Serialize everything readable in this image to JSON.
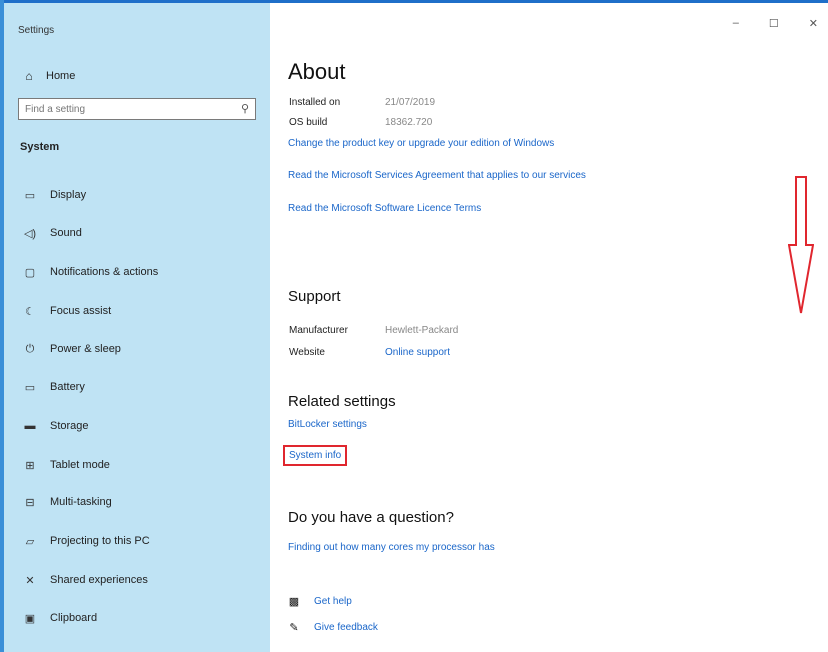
{
  "window": {
    "title": "Settings",
    "controls": {
      "minimize": "–",
      "maximize": "☐",
      "close": "✕"
    }
  },
  "sidebar": {
    "home": {
      "icon": "home-icon",
      "glyph": "⌂",
      "label": "Home"
    },
    "search": {
      "placeholder": "Find a setting",
      "icon": "search-icon",
      "glyph": "⚲"
    },
    "section": "System",
    "items": [
      {
        "icon": "display-icon",
        "glyph": "▭",
        "label": "Display"
      },
      {
        "icon": "sound-icon",
        "glyph": "◁)",
        "label": "Sound"
      },
      {
        "icon": "notifications-icon",
        "glyph": "▢",
        "label": "Notifications & actions"
      },
      {
        "icon": "focus-assist-icon",
        "glyph": "☾",
        "label": "Focus assist"
      },
      {
        "icon": "power-icon",
        "glyph": "⏻",
        "label": "Power & sleep"
      },
      {
        "icon": "battery-icon",
        "glyph": "▭",
        "label": "Battery"
      },
      {
        "icon": "storage-icon",
        "glyph": "▬",
        "label": "Storage"
      },
      {
        "icon": "tablet-icon",
        "glyph": "⊞",
        "label": "Tablet mode"
      },
      {
        "icon": "multitasking-icon",
        "glyph": "⊟",
        "label": "Multi-tasking"
      },
      {
        "icon": "projecting-icon",
        "glyph": "▱",
        "label": "Projecting to this PC"
      },
      {
        "icon": "shared-experiences-icon",
        "glyph": "✕",
        "label": "Shared experiences"
      },
      {
        "icon": "clipboard-icon",
        "glyph": "▣",
        "label": "Clipboard"
      }
    ]
  },
  "main": {
    "title": "About",
    "specs": [
      {
        "label": "Installed on",
        "value": "21/07/2019"
      },
      {
        "label": "OS build",
        "value": "18362.720"
      }
    ],
    "links": [
      "Change the product key or upgrade your edition of Windows",
      "Read the Microsoft Services Agreement that applies to our services",
      "Read the Microsoft Software Licence Terms"
    ],
    "support": {
      "heading": "Support",
      "manufacturer_label": "Manufacturer",
      "manufacturer_value": "Hewlett-Packard",
      "website_label": "Website",
      "website_value": "Online support"
    },
    "related": {
      "heading": "Related settings",
      "bitlocker": "BitLocker settings",
      "system_info": "System info"
    },
    "question": {
      "heading": "Do you have a question?",
      "link": "Finding out how many cores my processor has"
    },
    "help": {
      "get_help": "Get help",
      "feedback": "Give feedback"
    },
    "annotation_color": "#e0262e"
  }
}
